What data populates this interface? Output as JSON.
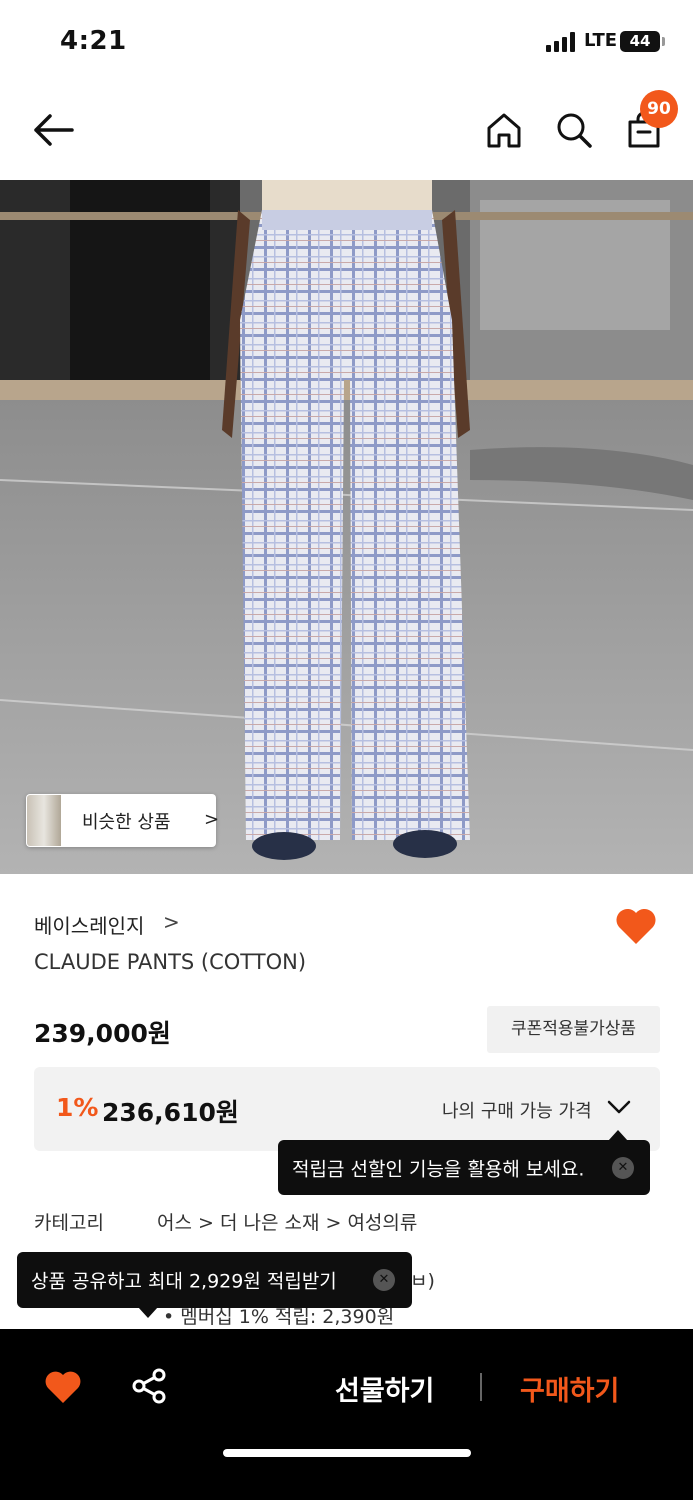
{
  "status_bar": {
    "time": "4:21",
    "network": "LTE",
    "battery": "44"
  },
  "header": {
    "cart_count": "90"
  },
  "similar_button": {
    "label": "비슷한 상품",
    "chevron": ">"
  },
  "product": {
    "brand": "베이스레인지",
    "brand_chevron": ">",
    "name": "CLAUDE PANTS (COTTON)",
    "price": "239,000원",
    "coupon_tag": "쿠폰적용불가상품",
    "my_price": {
      "discount": "1%",
      "amount": "236,610원",
      "label": "나의 구매 가능 가격"
    },
    "category_label": "카테고리",
    "category_path": "어스 > 더 나은 소재 > 여성의류",
    "partial_text": "ㅂ)",
    "membership_bullet": "•   멤버십 1% 적립: 2,390원"
  },
  "tooltips": {
    "savings": "적립금 선할인 기능을 활용해 보세요.",
    "share": "상품 공유하고 최대 2,929원 적립받기"
  },
  "bottom_bar": {
    "gift": "선물하기",
    "buy": "구매하기"
  },
  "colors": {
    "accent": "#f2581b",
    "dark": "#000000"
  }
}
